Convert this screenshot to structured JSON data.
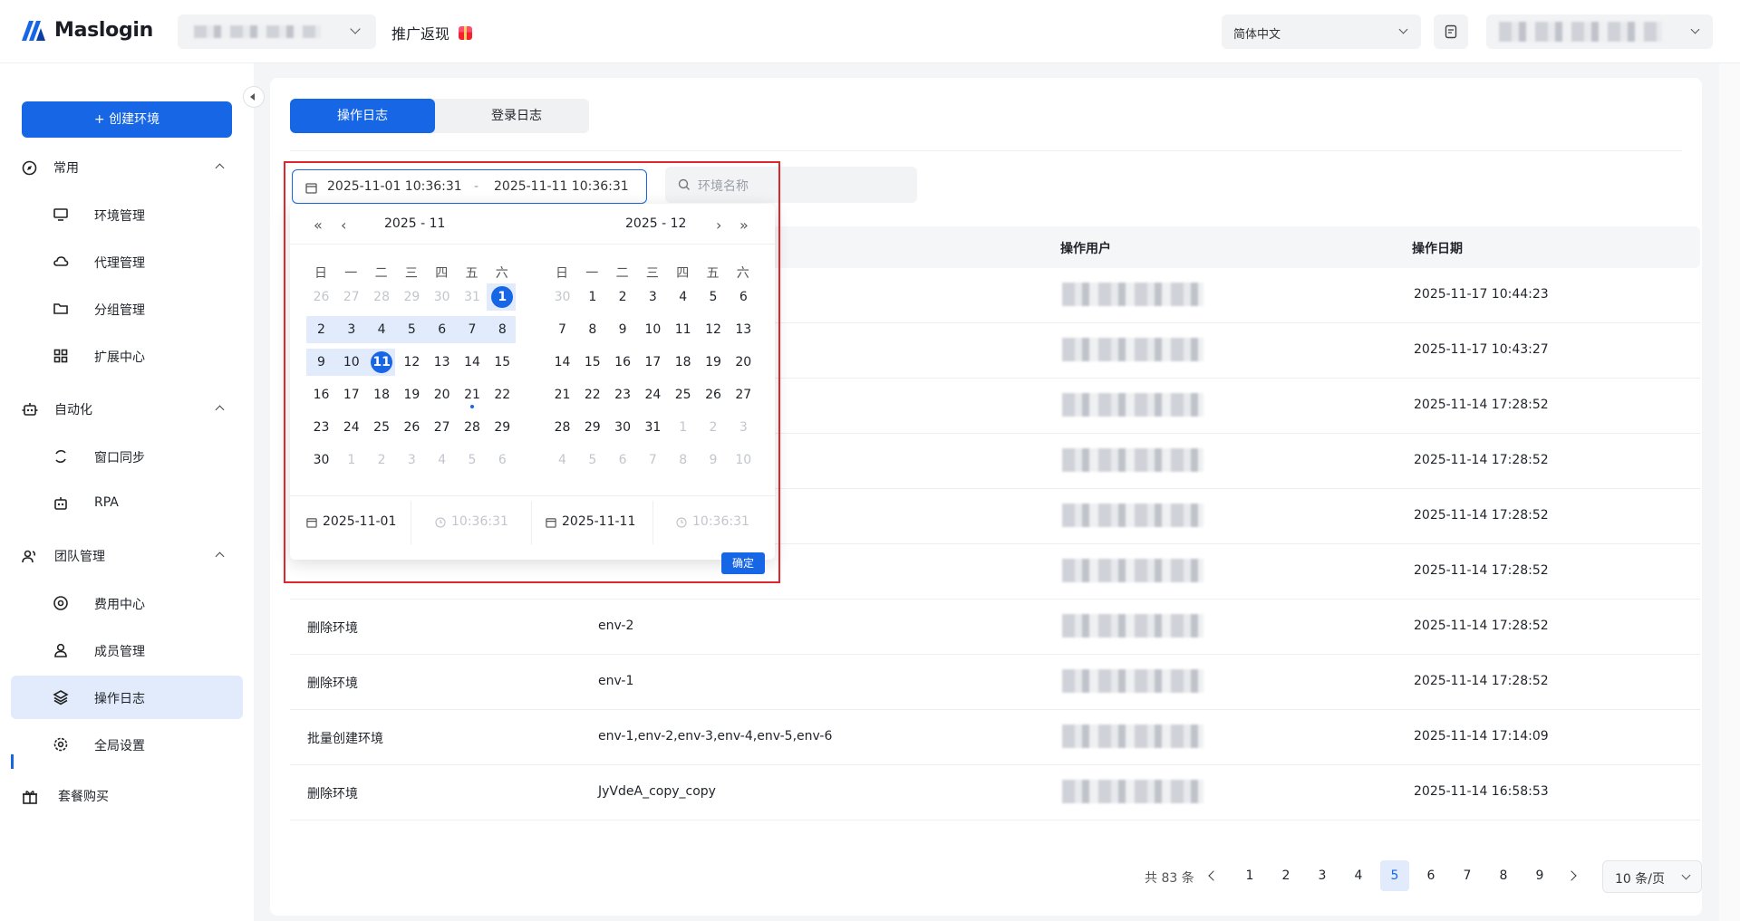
{
  "app": {
    "brand": "Maslogin",
    "promo": "推广返现",
    "language": "简体中文"
  },
  "sidebar": {
    "create_button": "+ 创建环境",
    "sections": [
      {
        "label": "常用",
        "items": [
          "环境管理",
          "代理管理",
          "分组管理",
          "扩展中心"
        ]
      },
      {
        "label": "自动化",
        "items": [
          "窗口同步",
          "RPA"
        ]
      },
      {
        "label": "团队管理",
        "items": [
          "费用中心",
          "成员管理",
          "操作日志",
          "全局设置"
        ]
      }
    ],
    "bottom_item": "套餐购买",
    "active_item": "操作日志"
  },
  "tabs": {
    "op_log": "操作日志",
    "login_log": "登录日志"
  },
  "filter": {
    "start": "2025-11-01 10:36:31",
    "separator": "-",
    "end": "2025-11-11 10:36:31",
    "search_placeholder": "环境名称"
  },
  "table": {
    "headers": {
      "user": "操作用户",
      "date": "操作日期"
    },
    "rows": [
      {
        "action": "",
        "target": "",
        "date": "2025-11-17 10:44:23"
      },
      {
        "action": "",
        "target": "",
        "date": "2025-11-17 10:43:27"
      },
      {
        "action": "",
        "target": "",
        "date": "2025-11-14 17:28:52"
      },
      {
        "action": "",
        "target": "",
        "date": "2025-11-14 17:28:52"
      },
      {
        "action": "",
        "target": "",
        "date": "2025-11-14 17:28:52"
      },
      {
        "action": "",
        "target": "",
        "date": "2025-11-14 17:28:52"
      },
      {
        "action": "删除环境",
        "target": "env-2",
        "date": "2025-11-14 17:28:52"
      },
      {
        "action": "删除环境",
        "target": "env-1",
        "date": "2025-11-14 17:28:52"
      },
      {
        "action": "批量创建环境",
        "target": "env-1,env-2,env-3,env-4,env-5,env-6",
        "date": "2025-11-14 17:14:09"
      },
      {
        "action": "删除环境",
        "target": "JyVdeA_copy_copy",
        "date": "2025-11-14 16:58:53"
      }
    ]
  },
  "pagination": {
    "total": "共 83 条",
    "pages": [
      "1",
      "2",
      "3",
      "4",
      "5",
      "6",
      "7",
      "8",
      "9"
    ],
    "current": "5",
    "page_size": "10 条/页"
  },
  "calendar": {
    "left_title": "2025 - 11",
    "right_title": "2025 - 12",
    "weekdays": [
      "日",
      "一",
      "二",
      "三",
      "四",
      "五",
      "六"
    ],
    "left_days": [
      "26",
      "27",
      "28",
      "29",
      "30",
      "31",
      "1",
      "2",
      "3",
      "4",
      "5",
      "6",
      "7",
      "8",
      "9",
      "10",
      "11",
      "12",
      "13",
      "14",
      "15",
      "16",
      "17",
      "18",
      "19",
      "20",
      "21",
      "22",
      "23",
      "24",
      "25",
      "26",
      "27",
      "28",
      "29",
      "30",
      "1",
      "2",
      "3",
      "4",
      "5",
      "6"
    ],
    "right_days": [
      "30",
      "1",
      "2",
      "3",
      "4",
      "5",
      "6",
      "7",
      "8",
      "9",
      "10",
      "11",
      "12",
      "13",
      "14",
      "15",
      "16",
      "17",
      "18",
      "19",
      "20",
      "21",
      "22",
      "23",
      "24",
      "25",
      "26",
      "27",
      "28",
      "29",
      "30",
      "31",
      "1",
      "2",
      "3",
      "4",
      "5",
      "6",
      "7",
      "8",
      "9",
      "10"
    ],
    "footer": {
      "start_date": "2025-11-01",
      "start_time": "10:36:31",
      "end_date": "2025-11-11",
      "end_time": "10:36:31"
    },
    "confirm": "确定"
  },
  "colors": {
    "accent": "#1766e6",
    "highlight": "#e0262c"
  }
}
